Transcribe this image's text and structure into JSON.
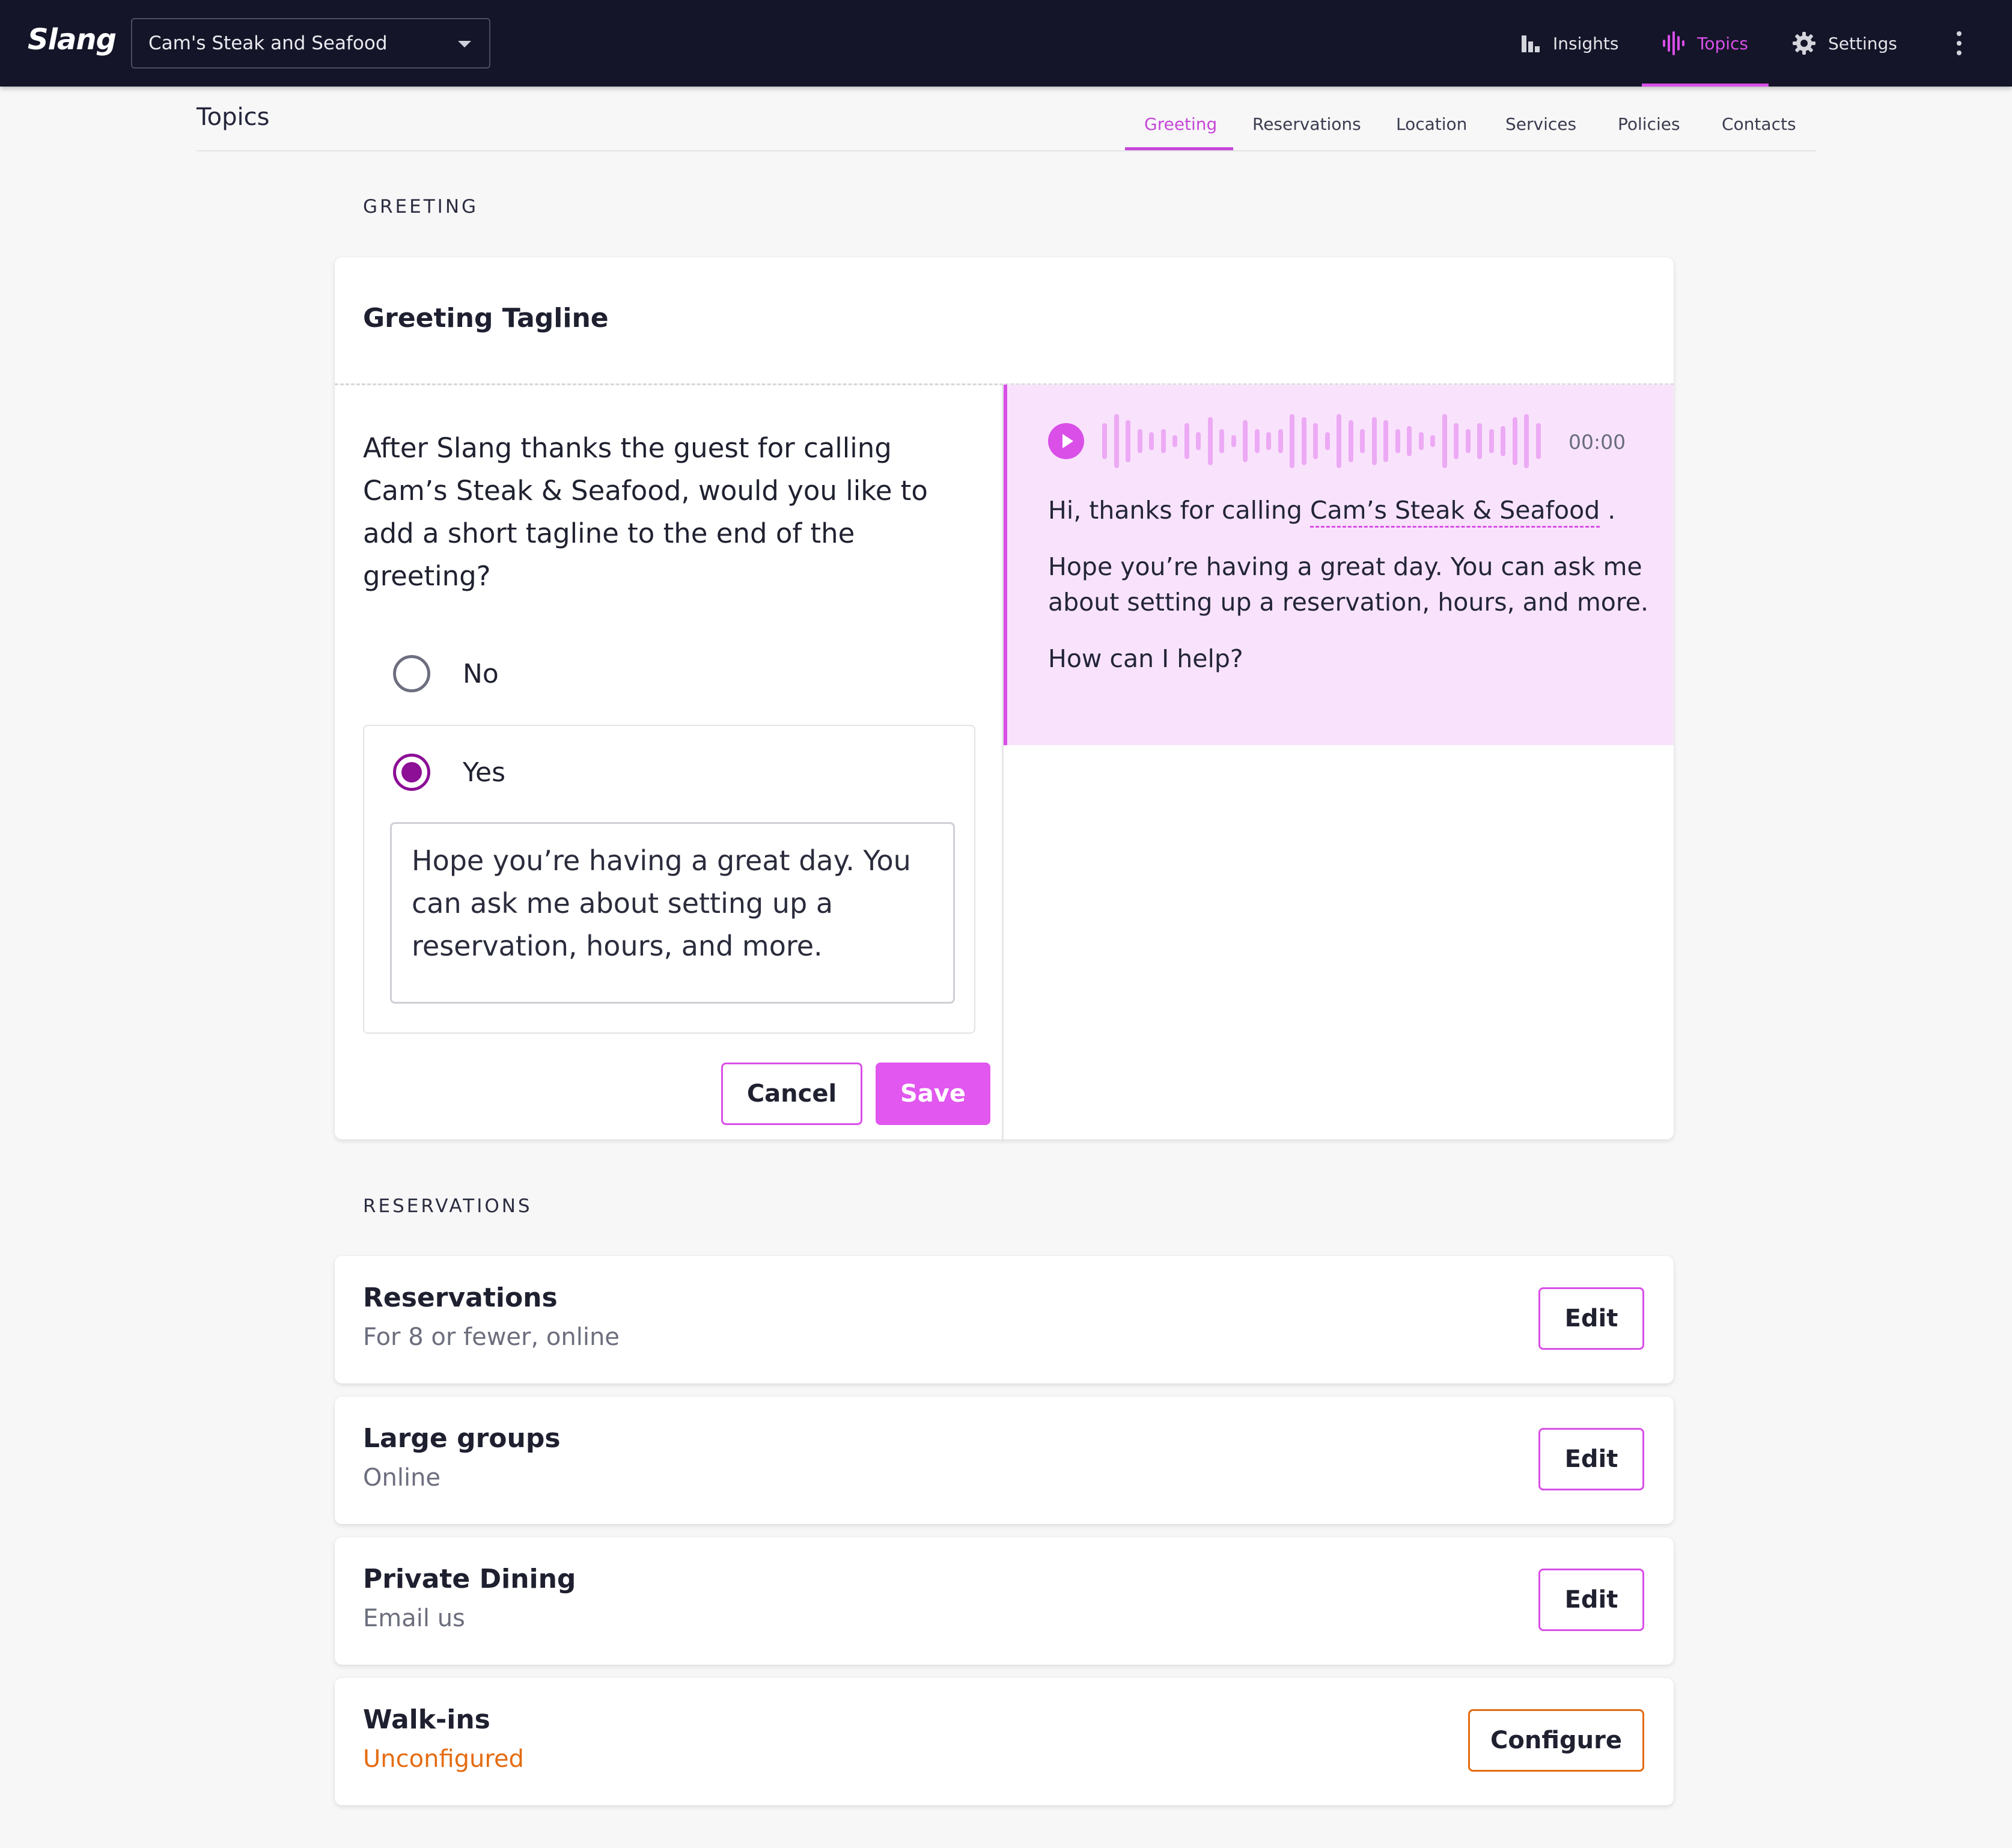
{
  "topbar": {
    "logo": "Slang",
    "business_select": "Cam's Steak and Seafood",
    "nav": [
      {
        "label": "Insights",
        "icon": "bar-chart-icon",
        "active": false
      },
      {
        "label": "Topics",
        "icon": "waveform-icon",
        "active": true
      },
      {
        "label": "Settings",
        "icon": "gear-icon",
        "active": false
      }
    ]
  },
  "page": {
    "title": "Topics",
    "tabs": [
      "Greeting",
      "Reservations",
      "Location",
      "Services",
      "Policies",
      "Contacts"
    ],
    "active_tab": "Greeting"
  },
  "greeting": {
    "section_label": "GREETING",
    "card_title": "Greeting Tagline",
    "question": "After Slang thanks the guest for calling Cam’s Steak & Seafood, would you like to add a short tagline to the end of the greeting?",
    "options": {
      "no": "No",
      "yes": "Yes",
      "selected": "Yes"
    },
    "tagline_value": "Hope you’re having a great day. You can ask me about setting up a reservation, hours, and more.",
    "cancel_label": "Cancel",
    "save_label": "Save",
    "preview": {
      "timecode": "00:00",
      "line1_prefix": "Hi, thanks for calling ",
      "line1_business": "Cam’s Steak & Seafood",
      "line1_suffix": " .",
      "line2": "Hope you’re having a great day. You can ask me about setting up a reservation, hours, and more.",
      "line3": "How can I help?"
    }
  },
  "reservations": {
    "section_label": "RESERVATIONS",
    "items": [
      {
        "title": "Reservations",
        "subtitle": "For 8 or fewer, online",
        "action": "Edit"
      },
      {
        "title": "Large groups",
        "subtitle": "Online",
        "action": "Edit"
      },
      {
        "title": "Private Dining",
        "subtitle": "Email us",
        "action": "Edit"
      },
      {
        "title": "Walk-ins",
        "subtitle": "Unconfigured",
        "action": "Configure"
      }
    ]
  },
  "colors": {
    "accent": "#d94fe8",
    "radio_selected": "#8c0f96",
    "topbar": "#141528",
    "warning": "#e46c12",
    "preview_bg": "#f9e3fc"
  }
}
